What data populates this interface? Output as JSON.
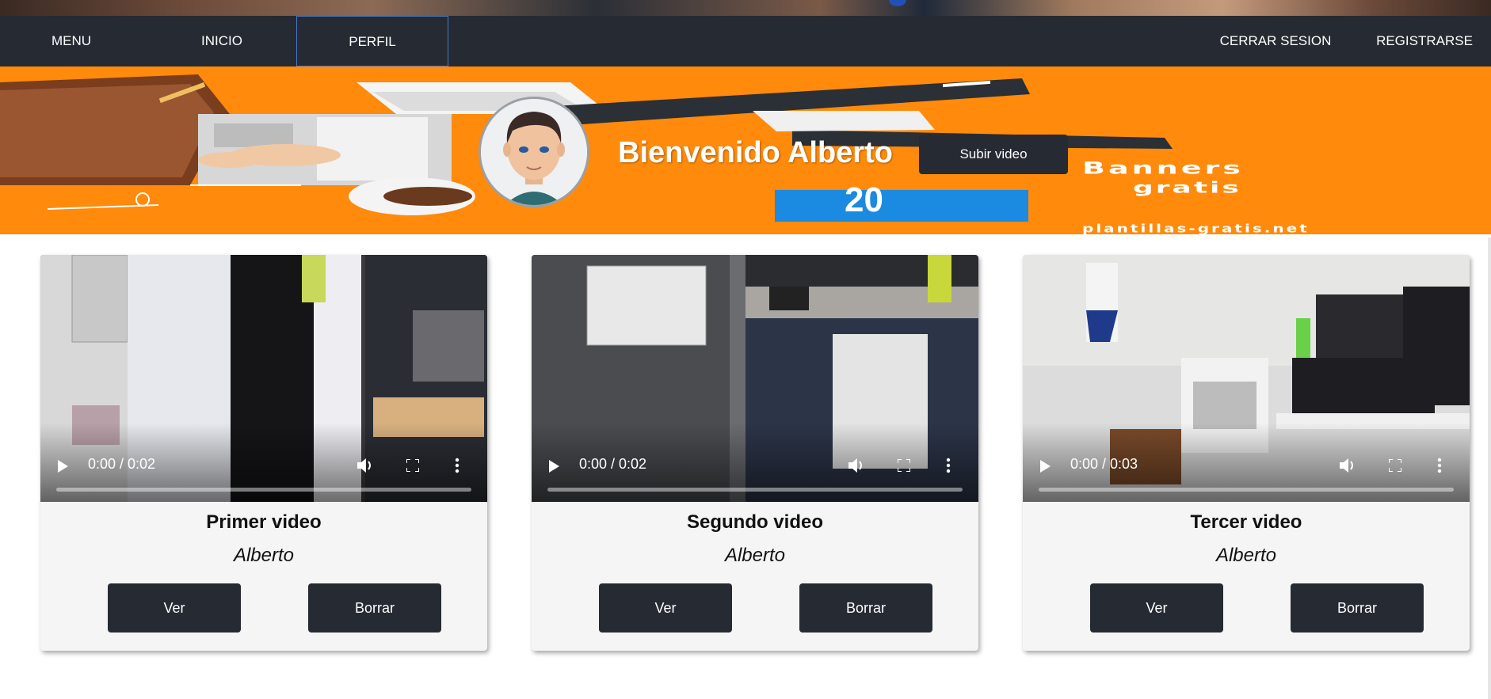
{
  "nav": {
    "items": [
      {
        "label": "MENU"
      },
      {
        "label": "INICIO"
      },
      {
        "label": "PERFIL"
      },
      {
        "label": "CERRAR SESION"
      },
      {
        "label": "REGISTRARSE"
      }
    ],
    "active": "PERFIL"
  },
  "banner": {
    "welcome": "Bienvenido Alberto",
    "upload_label": "Subir video",
    "art_text_1": "Banners",
    "art_text_2": "gratis",
    "art_text_3": "plantillas-gratis.net",
    "art_text_20": "20"
  },
  "videos": [
    {
      "title": "Primer video",
      "author": "Alberto",
      "time": "0:00 / 0:02",
      "progress": 0.0,
      "view_label": "Ver",
      "delete_label": "Borrar"
    },
    {
      "title": "Segundo video",
      "author": "Alberto",
      "time": "0:00 / 0:02",
      "progress": 0.0,
      "view_label": "Ver",
      "delete_label": "Borrar"
    },
    {
      "title": "Tercer video",
      "author": "Alberto",
      "time": "0:00 / 0:03",
      "progress": 0.0,
      "view_label": "Ver",
      "delete_label": "Borrar"
    }
  ],
  "colors": {
    "nav_bg": "#262a33",
    "banner_bg": "#ff8a0b",
    "button_bg": "#262a33",
    "card_bg": "#f5f5f5"
  }
}
